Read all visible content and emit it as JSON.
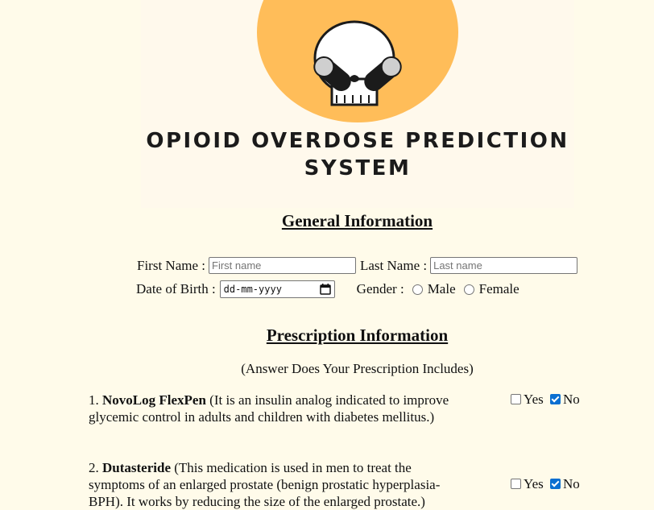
{
  "logo": {
    "title_line1": "OPIOID OVERDOSE PREDICTION",
    "title_line2": "SYSTEM",
    "colors": {
      "circle": "#ffbd59",
      "skull": "#ffffff",
      "outline": "#1b1b1b"
    }
  },
  "general": {
    "heading": "General Information",
    "first_name_label": "First Name :",
    "first_name_placeholder": "First name",
    "last_name_label": "Last Name :",
    "last_name_placeholder": "Last name",
    "dob_label": "Date of Birth :",
    "dob_placeholder": "dd-mm-yyyy",
    "gender_label": "Gender :",
    "gender_options": [
      "Male",
      "Female"
    ]
  },
  "prescription": {
    "heading": "Prescription Information",
    "subtitle": "(Answer Does Your Prescription Includes)",
    "questions": [
      {
        "number": "1.",
        "name": "NovoLog FlexPen",
        "description": "(It is an insulin analog indicated to improve glycemic control in adults and children with diabetes mellitus.)",
        "yes_label": "Yes",
        "no_label": "No",
        "selected": "No"
      },
      {
        "number": "2.",
        "name": "Dutasteride",
        "description": "(This medication is used in men to treat the symptoms of an enlarged prostate (benign prostatic hyperplasia-BPH). It works by reducing the size of the enlarged prostate.)",
        "yes_label": "Yes",
        "no_label": "No",
        "selected": "No"
      }
    ]
  }
}
